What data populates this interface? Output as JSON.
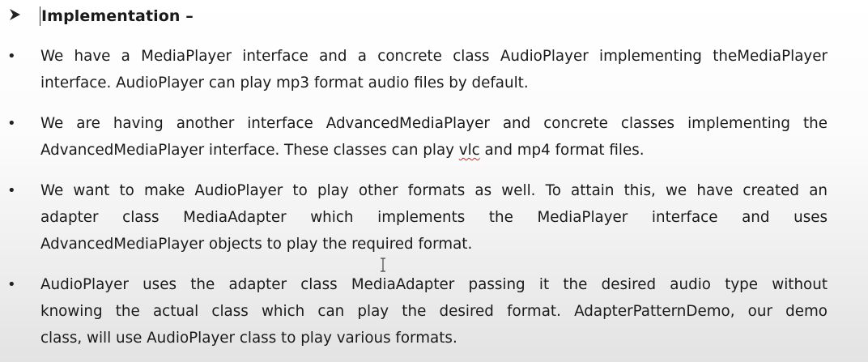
{
  "heading": {
    "marker_icon": "arrow-right-bullet-icon",
    "text": "Implementation –"
  },
  "bullets": [
    {
      "lines": [
        "We have a MediaPlayer interface and a concrete class AudioPlayer implementing theMediaPlayer",
        "interface. AudioPlayer can play mp3 format audio files by default."
      ]
    },
    {
      "line1": "We are having another interface AdvancedMediaPlayer and concrete classes implementing the",
      "line2_before": "AdvancedMediaPlayer interface. These classes can play ",
      "line2_flagged": "vlc",
      "line2_after": " and mp4 format files."
    },
    {
      "lines": [
        "We want to make AudioPlayer to play other formats as well. To attain this, we have created an",
        "adapter class MediaAdapter which implements the MediaPlayer interface and uses",
        "AdvancedMediaPlayer objects to play the required format."
      ]
    },
    {
      "lines": [
        "AudioPlayer uses the adapter class MediaAdapter passing it the desired audio type without",
        "knowing the actual class which can play the desired format. AdapterPatternDemo, our demo",
        "class, will use AudioPlayer class to play various formats."
      ]
    }
  ],
  "bullet_symbol": "•",
  "colors": {
    "text": "#1a1a1a",
    "spellcheck_underline": "#d22"
  },
  "cursor_icon": "text-ibeam-cursor-icon"
}
